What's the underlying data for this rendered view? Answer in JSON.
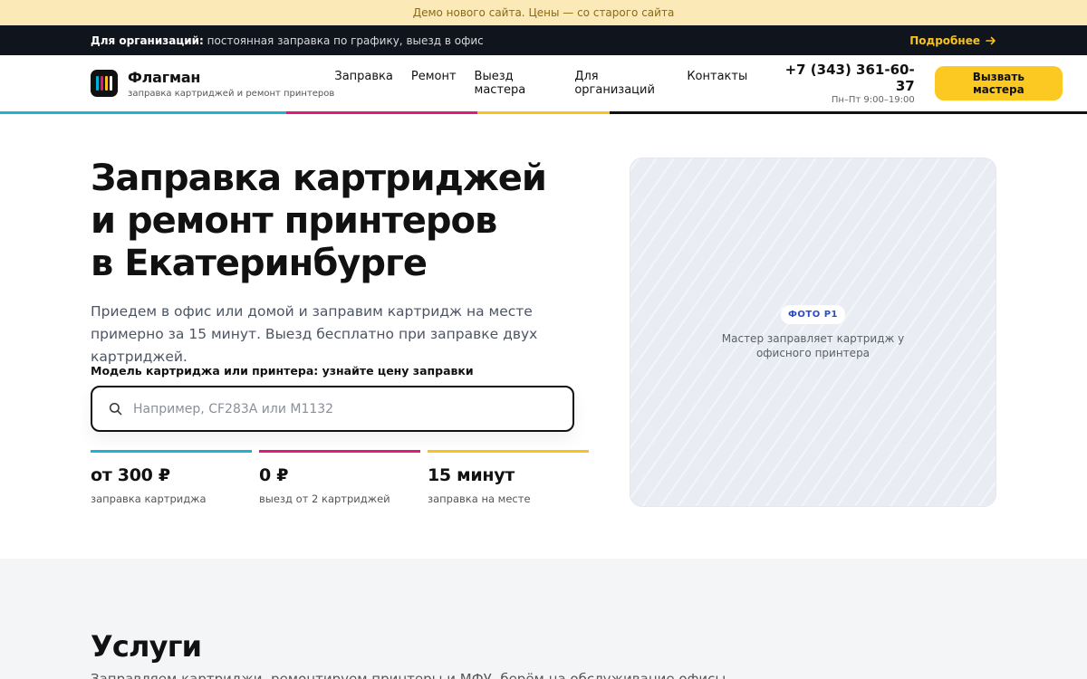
{
  "demo_banner": "Демо нового сайта. Цены — со старого сайта",
  "org_bar": {
    "label": "Для организаций:",
    "text": "постоянная заправка по графику, выезд в офис",
    "more": "Подробнее"
  },
  "brand": {
    "name": "Флагман",
    "tagline": "заправка картриджей и ремонт принтеров",
    "logo_colors": [
      "#00b0d8",
      "#e2187a",
      "#f7c31c",
      "#ffffff"
    ]
  },
  "nav": [
    "Заправка",
    "Ремонт",
    "Выезд мастера",
    "Для организаций",
    "Контакты"
  ],
  "contact": {
    "phone": "+7 (343) 361-60-37",
    "hours": "Пн–Пт 9:00–19:00"
  },
  "cta_label": "Вызвать мастера",
  "accent_colors": {
    "cyan": "#1bb3d6",
    "magenta": "#e0197d",
    "yellow": "#f7c31c",
    "black": "#111111"
  },
  "hero": {
    "title_lines": [
      "Заправка картриджей",
      "и ремонт принтеров",
      "в Екатеринбурге"
    ],
    "text": "Приедем в офис или домой и заправим картридж на месте примерно за 15 минут. Выезд бесплатно при заправке двух картриджей.",
    "search_label": "Модель картриджа или принтера: узнайте цену заправки",
    "search_placeholder": "Например, CF283A или M1132",
    "stats": [
      {
        "value": "от 300 ₽",
        "label": "заправка картриджа",
        "color": "#1bb3d6"
      },
      {
        "value": "0 ₽",
        "label": "выезд от 2 картриджей",
        "color": "#e0197d"
      },
      {
        "value": "15 минут",
        "label": "заправка на месте",
        "color": "#f7c31c"
      }
    ],
    "photo_badge": "ФОТО P1",
    "photo_caption": "Мастер заправляет картридж у офисного принтера"
  },
  "services": {
    "title": "Услуги",
    "subtitle": "Заправляем картриджи, ремонтируем принтеры и МФУ, берём на обслуживание офисы"
  }
}
